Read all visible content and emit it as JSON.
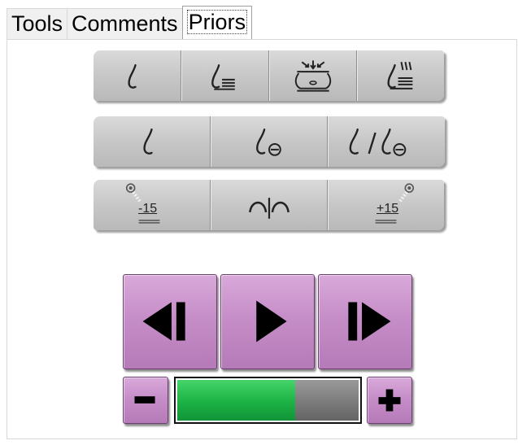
{
  "tabs": [
    {
      "label": "Tools",
      "active": false
    },
    {
      "label": "Comments",
      "active": false
    },
    {
      "label": "Priors",
      "active": true
    }
  ],
  "row1": {
    "buttons": [
      {
        "icon": "breast-icon"
      },
      {
        "icon": "breast-with-lines-icon"
      },
      {
        "icon": "compression-paddle-icon"
      },
      {
        "icon": "breast-with-rays-icon"
      }
    ]
  },
  "row2": {
    "buttons": [
      {
        "icon": "breast-icon"
      },
      {
        "icon": "breast-minus-icon"
      },
      {
        "icon": "breast-compare-icon"
      }
    ]
  },
  "row3": {
    "buttons": [
      {
        "icon": "tube-angle-left-icon",
        "label": "-15"
      },
      {
        "icon": "arc-split-icon"
      },
      {
        "icon": "tube-angle-right-icon",
        "label": "+15"
      }
    ]
  },
  "playback": {
    "buttons": [
      {
        "icon": "step-back-icon"
      },
      {
        "icon": "play-icon"
      },
      {
        "icon": "step-forward-icon"
      }
    ]
  },
  "speed": {
    "minus_icon": "minus-icon",
    "plus_icon": "plus-icon",
    "level": 0.65
  },
  "colors": {
    "accent_purple": "#c68ec8",
    "progress_green": "#1fb547",
    "button_gray": "#c7c7c7"
  }
}
